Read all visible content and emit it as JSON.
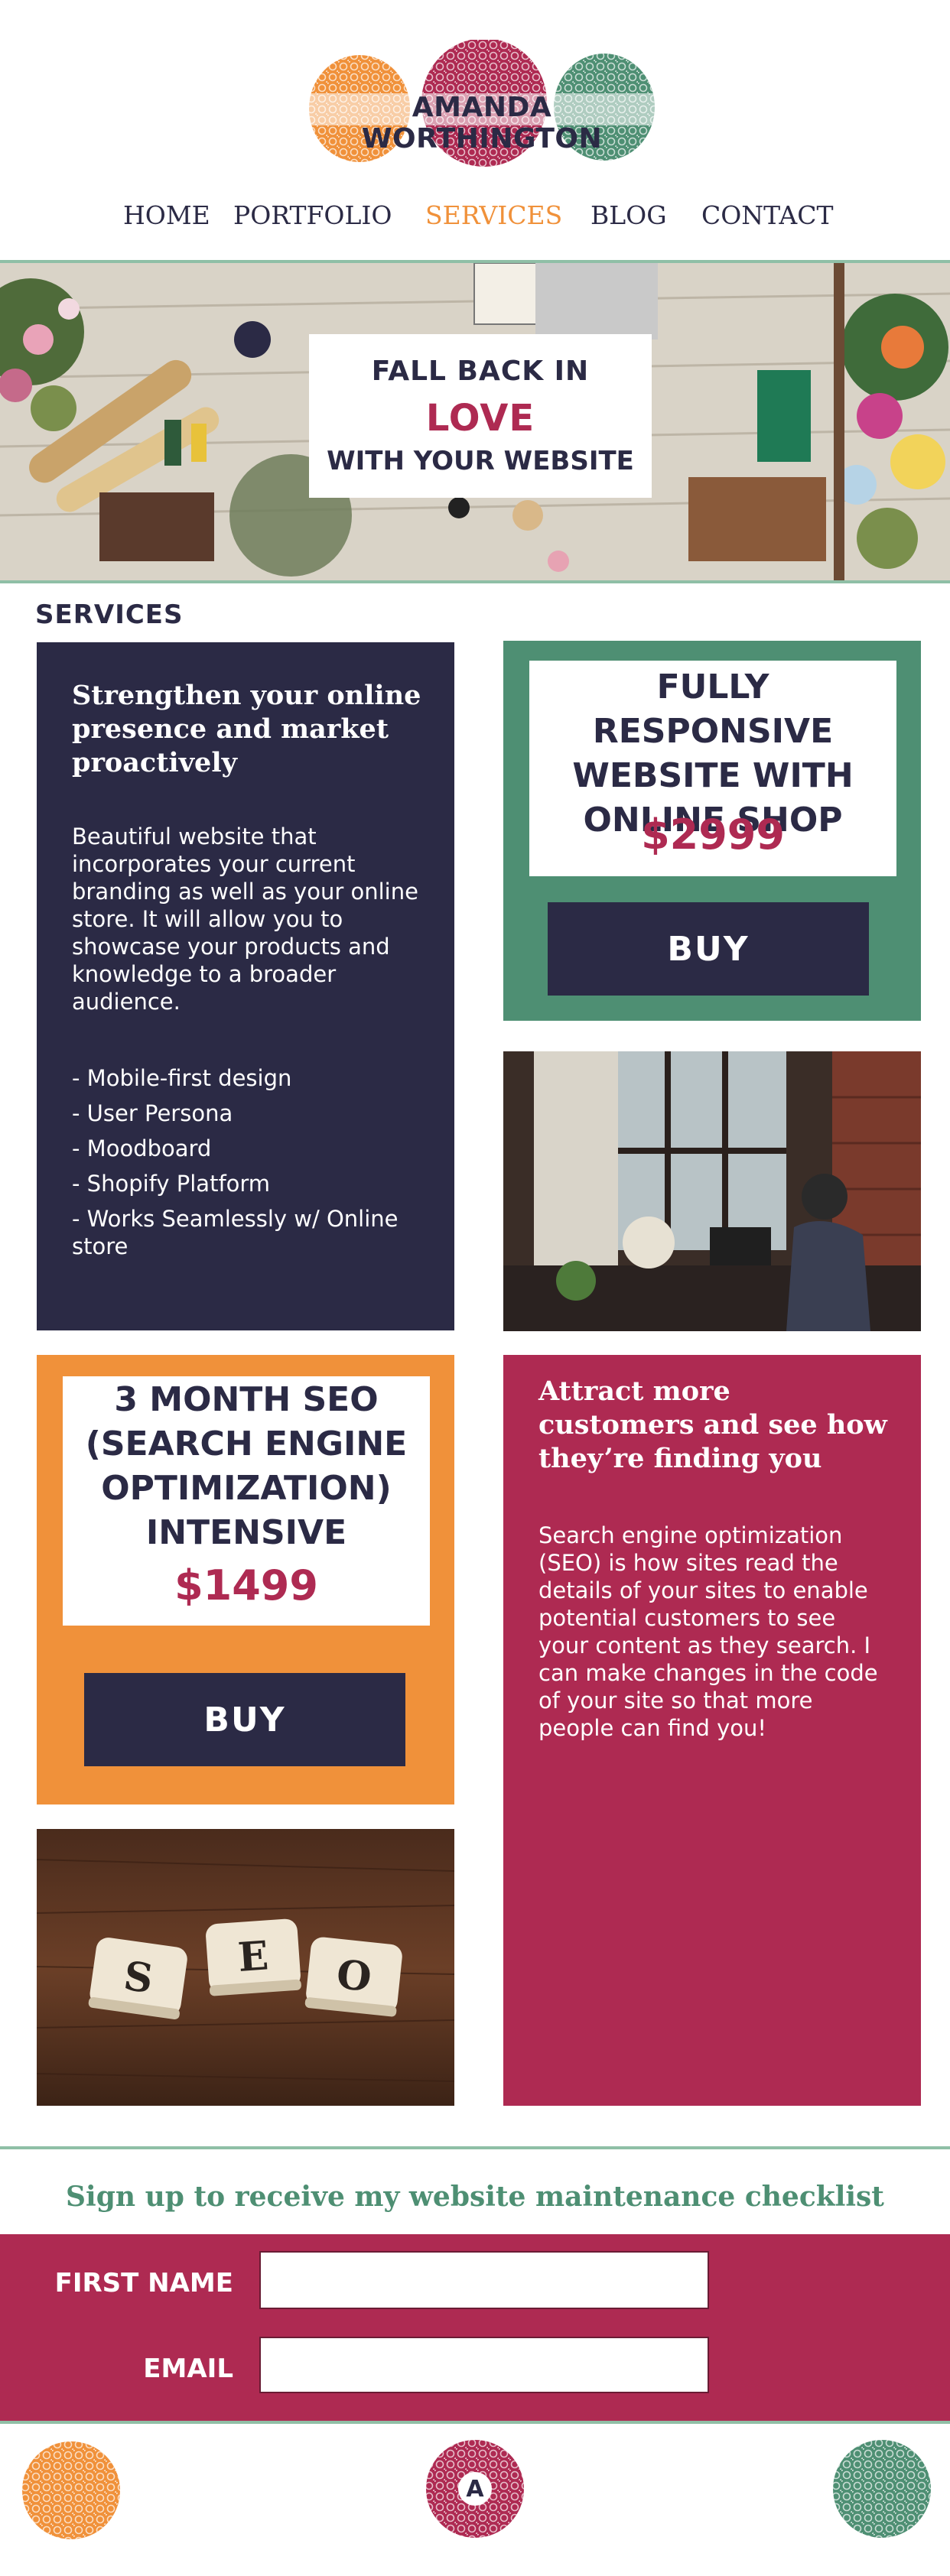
{
  "brand": {
    "name": "AMANDA WORTHINGTON",
    "colors": {
      "orange": "#f0913a",
      "berry": "#ae2a52",
      "green": "#4e8f73",
      "navy": "#2b2a45",
      "mint": "#8fbfa6"
    }
  },
  "nav": {
    "items": [
      {
        "label": "HOME"
      },
      {
        "label": "PORTFOLIO"
      },
      {
        "label": "SERVICES"
      },
      {
        "label": "BLOG"
      },
      {
        "label": "CONTACT"
      }
    ],
    "active": "SERVICES"
  },
  "hero": {
    "line1": "FALL BACK IN",
    "line2": "LOVE",
    "line3": "WITH YOUR WEBSITE"
  },
  "services": {
    "heading": "SERVICES",
    "website": {
      "title": "Strengthen your online presence and market proactively",
      "description": "Beautiful website that incorporates your current branding as well as your online store. It will allow you to showcase your products and knowledge to a broader audience.",
      "features": [
        "- Mobile-first design",
        "- User Persona",
        "- Moodboard",
        "- Shopify Platform",
        "- Works Seamlessly w/ Online store"
      ],
      "package_title": "FULLY RESPONSIVE WEBSITE WITH ONLINE SHOP",
      "price": "$2999",
      "buy_label": "BUY"
    },
    "seo": {
      "package_title": "3 MONTH SEO (SEARCH ENGINE OPTIMIZATION) INTENSIVE",
      "price": "$1499",
      "buy_label": "BUY",
      "title": "Attract more customers and see how they’re finding you",
      "description": "Search engine optimization (SEO) is how sites read the details of your sites to enable potential customers to see your content as they search. I can make changes in the code of your site so that more people can find you!"
    },
    "seo_tiles": [
      "S",
      "E",
      "O"
    ]
  },
  "signup": {
    "heading": "Sign up to receive my website maintenance checklist",
    "first_name_label": "FIRST NAME",
    "first_name_value": "",
    "email_label": "EMAIL",
    "email_value": ""
  },
  "footer": {
    "center_letter": "A"
  }
}
